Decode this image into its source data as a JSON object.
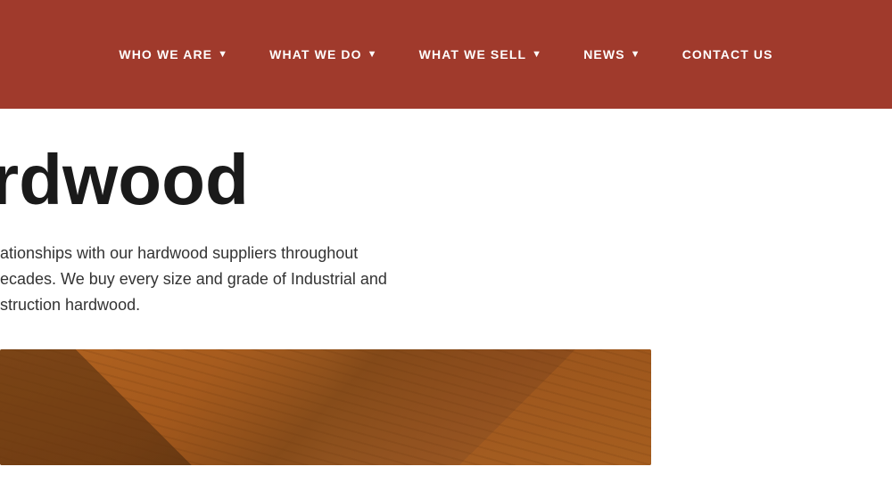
{
  "nav": {
    "background_color": "#a03a2c",
    "items": [
      {
        "id": "who-we-are",
        "label": "WHO WE ARE",
        "has_dropdown": true
      },
      {
        "id": "what-we-do",
        "label": "WHAT WE DO",
        "has_dropdown": true
      },
      {
        "id": "what-we-sell",
        "label": "WHAT WE SELL",
        "has_dropdown": true
      },
      {
        "id": "news",
        "label": "NEWS",
        "has_dropdown": true
      },
      {
        "id": "contact-us",
        "label": "CONTACT US",
        "has_dropdown": false
      }
    ]
  },
  "hero": {
    "title": "rdwood",
    "description_line1": "ationships with our hardwood suppliers throughout",
    "description_line2": "ecades. We buy every size and grade of Industrial and",
    "description_line3": "struction hardwood."
  }
}
